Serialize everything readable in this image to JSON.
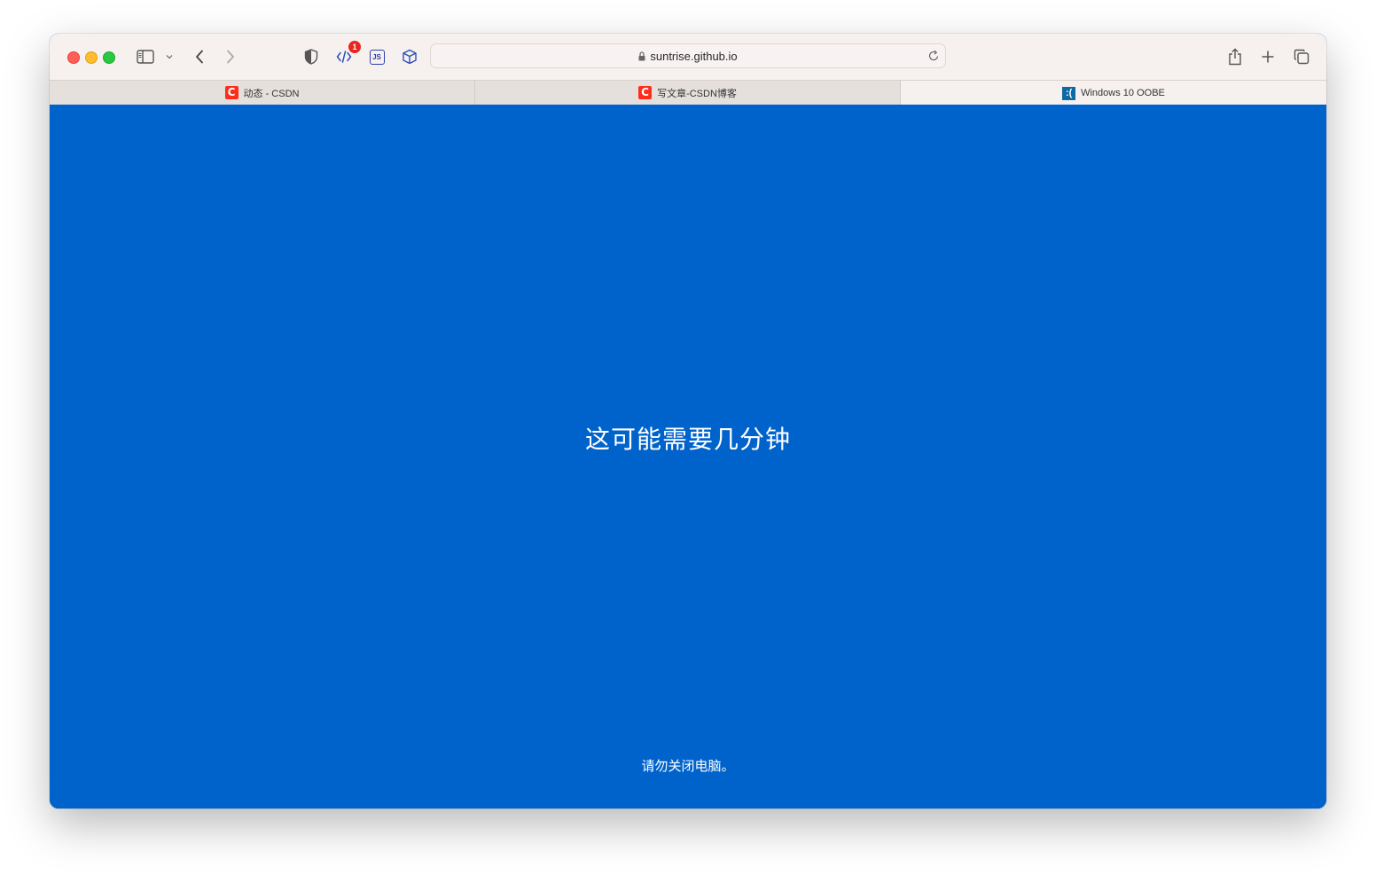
{
  "browser": {
    "url": "suntrise.github.io",
    "extension_badge": "1",
    "js_extension_label": "JS"
  },
  "tabs": [
    {
      "title": "动态 - CSDN",
      "favicon": "csdn-icon",
      "favicon_text": "C",
      "active": false
    },
    {
      "title": "写文章-CSDN博客",
      "favicon": "csdn-icon",
      "favicon_text": "C",
      "active": false
    },
    {
      "title": "Windows 10 OOBE",
      "favicon": "windows-oobe-icon",
      "favicon_text": ":(",
      "active": true
    }
  ],
  "page": {
    "main_message": "这可能需要几分钟",
    "sub_message": "请勿关闭电脑。",
    "background_color": "#0063cc"
  },
  "colors": {
    "traffic_red": "#fe5f57",
    "traffic_yellow": "#febc2e",
    "traffic_green": "#28c840",
    "csdn_red": "#fc2d1b",
    "badge_red": "#e8261f"
  }
}
